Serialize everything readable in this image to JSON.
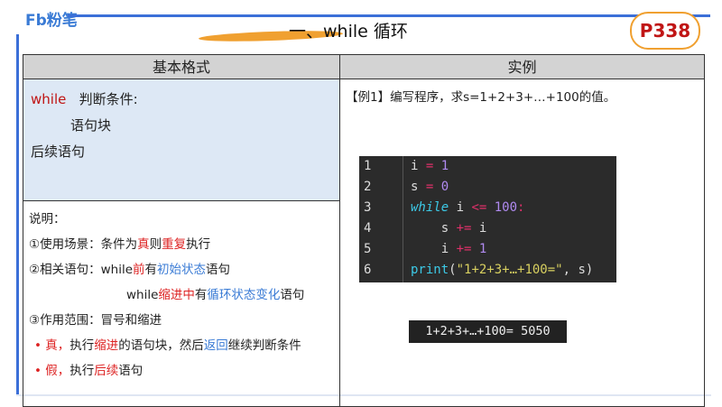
{
  "logo": "Fb粉笔",
  "title": "一、while 循环",
  "page_badge": "P338",
  "table": {
    "headers": [
      "基本格式",
      "实例"
    ],
    "format": {
      "kw": "while",
      "cond": "判断条件:",
      "block": "语句块",
      "after": "后续语句"
    },
    "notes": {
      "heading": "说明：",
      "l1": [
        "①使用场景：条件为",
        "真",
        "则",
        "重复",
        "执行"
      ],
      "l2": [
        "②相关语句：while",
        "前",
        "有",
        "初始状态",
        "语句"
      ],
      "l3": [
        "while",
        "缩进中",
        "有",
        "循环状态变化",
        "语句"
      ],
      "l4": "③作用范围：冒号和缩进",
      "l5": [
        "• ",
        "真，",
        "执行",
        "缩进",
        "的语句块，然后",
        "返回",
        "继续判断条件"
      ],
      "l6": [
        "• ",
        "假，",
        "执行",
        "后续",
        "语句"
      ]
    },
    "example": {
      "question": "【例1】编写程序，求s=1+2+3+…+100的值。",
      "line_numbers": [
        "1",
        "2",
        "3",
        "4",
        "5",
        "6"
      ],
      "output": "1+2+3+…+100= 5050"
    }
  }
}
